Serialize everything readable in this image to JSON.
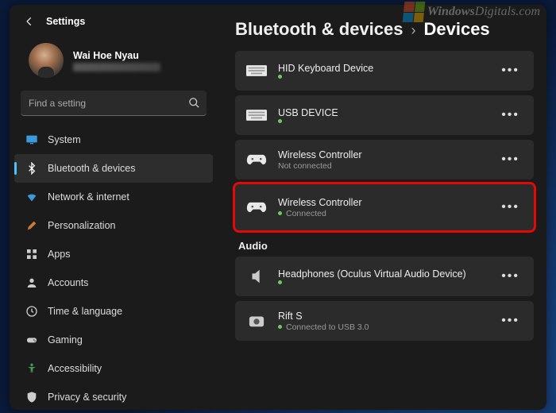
{
  "header": {
    "title": "Settings"
  },
  "user": {
    "name": "Wai Hoe Nyau"
  },
  "search": {
    "placeholder": "Find a setting"
  },
  "nav": [
    {
      "label": "System",
      "icon": "monitor",
      "active": false
    },
    {
      "label": "Bluetooth & devices",
      "icon": "bluetooth",
      "active": true
    },
    {
      "label": "Network & internet",
      "icon": "wifi",
      "active": false
    },
    {
      "label": "Personalization",
      "icon": "paint",
      "active": false
    },
    {
      "label": "Apps",
      "icon": "apps",
      "active": false
    },
    {
      "label": "Accounts",
      "icon": "person",
      "active": false
    },
    {
      "label": "Time & language",
      "icon": "clock",
      "active": false
    },
    {
      "label": "Gaming",
      "icon": "gamepad",
      "active": false
    },
    {
      "label": "Accessibility",
      "icon": "accessibility",
      "active": false
    },
    {
      "label": "Privacy & security",
      "icon": "shield",
      "active": false
    }
  ],
  "breadcrumb": {
    "parent": "Bluetooth & devices",
    "sep": "›",
    "current": "Devices"
  },
  "devices": [
    {
      "name": "HID Keyboard Device",
      "status": "",
      "dot": "green",
      "icon": "keyboard",
      "highlight": false
    },
    {
      "name": "USB DEVICE",
      "status": "",
      "dot": "green",
      "icon": "keyboard",
      "highlight": false
    },
    {
      "name": "Wireless Controller",
      "status": "Not connected",
      "dot": "",
      "icon": "controller",
      "highlight": false
    },
    {
      "name": "Wireless Controller",
      "status": "Connected",
      "dot": "green",
      "icon": "controller",
      "highlight": true
    }
  ],
  "audio_header": "Audio",
  "audio": [
    {
      "name": "Headphones (Oculus Virtual Audio Device)",
      "status": "",
      "dot": "green",
      "icon": "speaker"
    },
    {
      "name": "Rift S",
      "status": "Connected to USB 3.0",
      "dot": "green",
      "icon": "camera"
    }
  ],
  "watermark": {
    "text1": "Windows",
    "text2": "Digitals",
    "text3": ".com"
  }
}
